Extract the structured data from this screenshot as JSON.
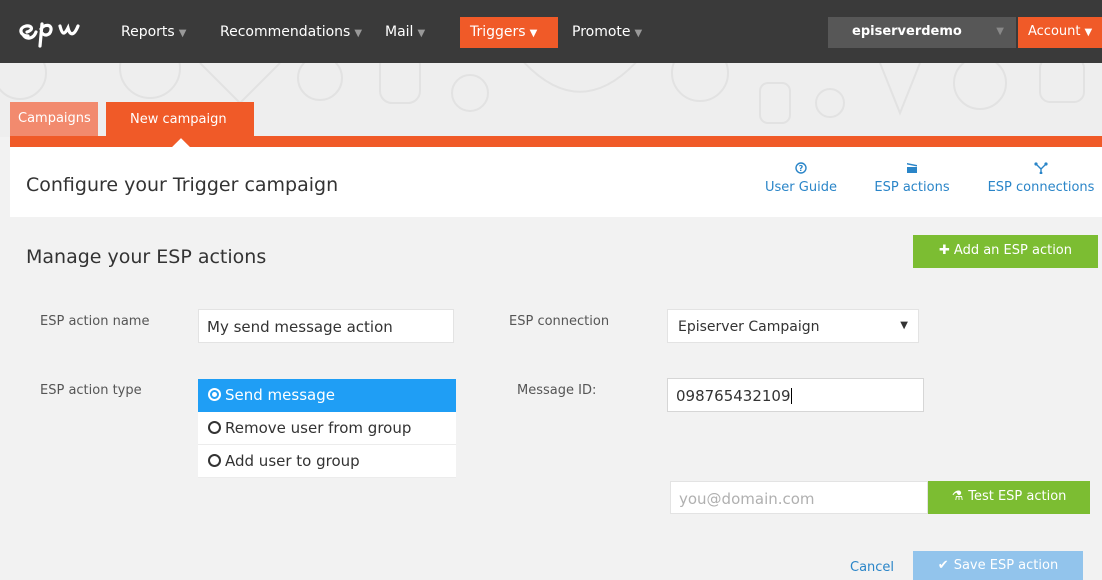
{
  "nav": {
    "items": [
      {
        "label": "Reports"
      },
      {
        "label": "Recommendations"
      },
      {
        "label": "Mail"
      },
      {
        "label": "Triggers"
      },
      {
        "label": "Promote"
      }
    ],
    "site": "episerverdemo",
    "account": "Account"
  },
  "tabs": {
    "campaigns": "Campaigns",
    "new_campaign": "New campaign"
  },
  "header": {
    "title": "Configure your Trigger campaign",
    "links": [
      {
        "label": "User Guide",
        "icon": "help-circle-icon"
      },
      {
        "label": "ESP actions",
        "icon": "clapperboard-icon"
      },
      {
        "label": "ESP connections",
        "icon": "connections-icon"
      }
    ]
  },
  "section": {
    "title": "Manage your ESP actions",
    "add_button": "Add an ESP action"
  },
  "form": {
    "name_label": "ESP action name",
    "name_value": "My send message action",
    "connection_label": "ESP connection",
    "connection_value": "Episerver Campaign",
    "type_label": "ESP action type",
    "type_options": [
      {
        "label": "Send message",
        "selected": true
      },
      {
        "label": "Remove user from group",
        "selected": false
      },
      {
        "label": "Add user to group",
        "selected": false
      }
    ],
    "message_id_label": "Message ID:",
    "message_id_value": "098765432109",
    "email_placeholder": "you@domain.com",
    "test_button": "Test ESP action",
    "cancel": "Cancel",
    "save_button": "Save ESP action"
  },
  "colors": {
    "brand_orange": "#f05a28",
    "nav_bg": "#3a3a3a",
    "green": "#7cbd32",
    "blue_selected": "#1f9ef5",
    "link_blue": "#2a85c8",
    "save_disabled": "#92c4ec"
  }
}
